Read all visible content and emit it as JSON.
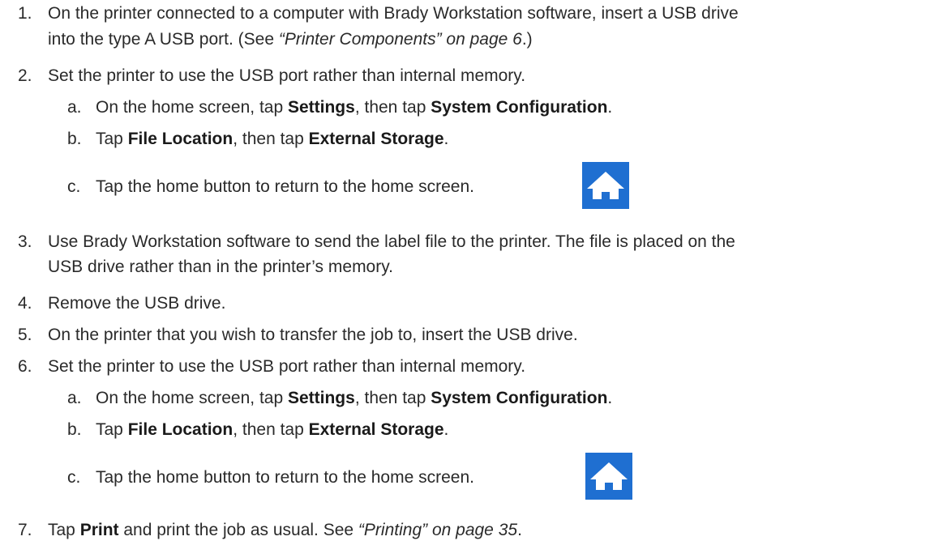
{
  "steps": [
    {
      "num": "1.",
      "line1": "On the printer connected to a computer with Brady Workstation software, insert a USB drive",
      "line2_pre": "into the type A USB port. (See ",
      "line2_ref": "“Printer Components” on page 6",
      "line2_post": ".)"
    },
    {
      "num": "2.",
      "text": "Set the printer to use the USB port rather than internal memory.",
      "substeps": [
        {
          "letter": "a.",
          "pre": "On the home screen, tap ",
          "b1": "Settings",
          "mid": ", then tap ",
          "b2": "System Configuration",
          "post": "."
        },
        {
          "letter": "b.",
          "pre": "Tap ",
          "b1": "File Location",
          "mid": ", then tap ",
          "b2": "External Storage",
          "post": "."
        },
        {
          "letter": "c.",
          "text": "Tap the home button to return to the home screen."
        }
      ]
    },
    {
      "num": "3.",
      "line1": "Use Brady Workstation software to send the label file to the printer. The file is placed on the",
      "line2": "USB drive rather than in the printer’s memory."
    },
    {
      "num": "4.",
      "text": "Remove the USB drive."
    },
    {
      "num": "5.",
      "text": "On the printer that you wish to transfer the job to, insert the USB drive."
    },
    {
      "num": "6.",
      "text": "Set the printer to use the USB port rather than internal memory.",
      "substeps": [
        {
          "letter": "a.",
          "pre": "On the home screen, tap ",
          "b1": "Settings",
          "mid": ", then tap ",
          "b2": "System Configuration",
          "post": "."
        },
        {
          "letter": "b.",
          "pre": "Tap ",
          "b1": "File Location",
          "mid": ", then tap ",
          "b2": "External Storage",
          "post": "."
        },
        {
          "letter": "c.",
          "text": "Tap the home button to return to the home screen."
        }
      ]
    },
    {
      "num": "7.",
      "pre": "Tap ",
      "b1": "Print",
      "mid": " and print the job as usual. See ",
      "ref": "“Printing” on page 35",
      "post": "."
    }
  ],
  "icons": {
    "home": "home-icon",
    "home_color": "#1f6fd1"
  }
}
